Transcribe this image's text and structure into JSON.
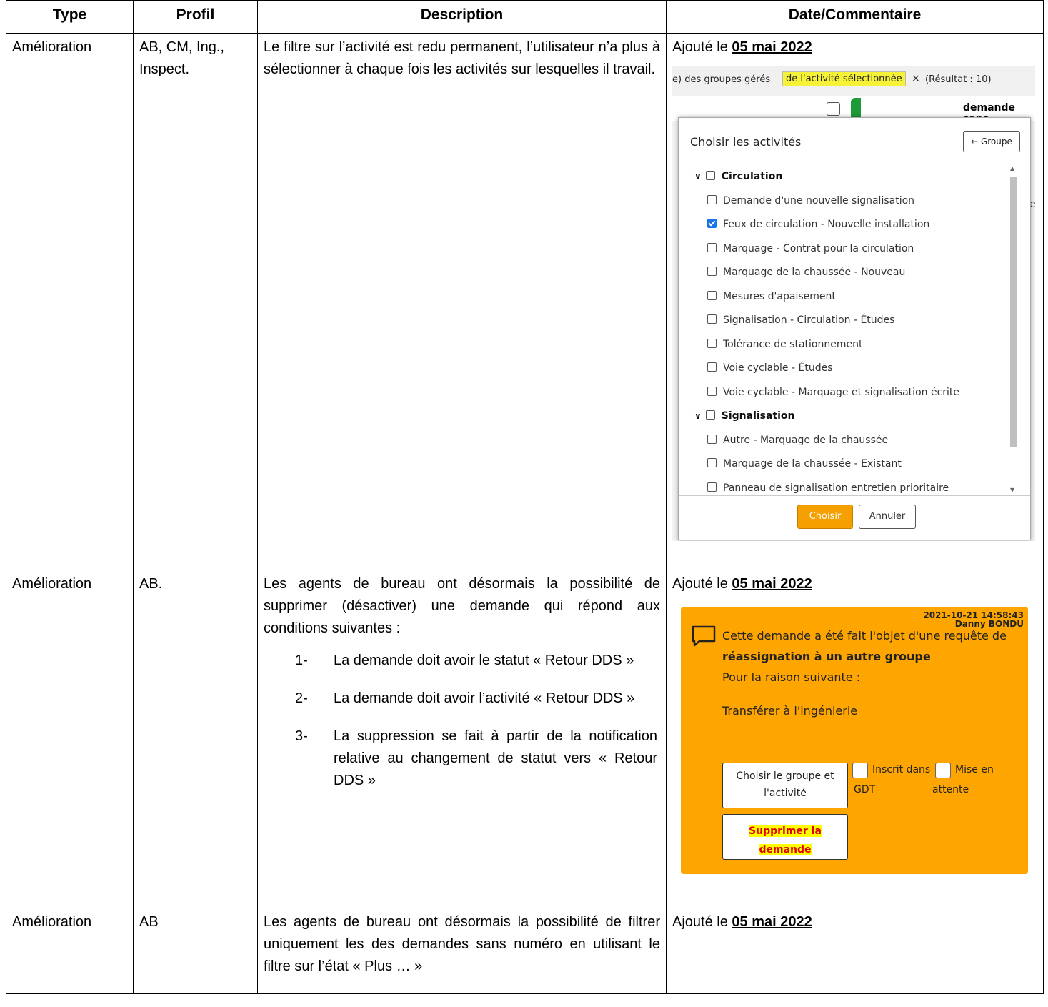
{
  "headers": {
    "type": "Type",
    "profil": "Profil",
    "description": "Description",
    "date": "Date/Commentaire"
  },
  "rows": [
    {
      "type": "Amélioration",
      "profil": "AB, CM, Ing., Inspect.",
      "description": "Le filtre sur l’activité est redu permanent, l’utilisateur n’a plus à sélectionner à chaque fois les activités sur lesquelles il travail.",
      "added_prefix": "Ajouté le ",
      "added_date": "05 mai 2022"
    },
    {
      "type": "Amélioration",
      "profil": "AB.",
      "description_intro": "Les agents de bureau ont désormais la possibilité de supprimer (désactiver) une demande qui répond aux conditions suivantes :",
      "conditions": [
        {
          "num": "1-",
          "text": "La demande doit avoir le statut « Retour DDS »"
        },
        {
          "num": "2-",
          "text": "La demande doit avoir l’activité « Retour DDS »"
        },
        {
          "num": "3-",
          "text": "La suppression se fait à partir de la notification relative au changement de statut vers « Retour DDS »"
        }
      ],
      "added_prefix": "Ajouté le ",
      "added_date": "05 mai 2022"
    },
    {
      "type": "Amélioration",
      "profil": "AB",
      "description": "Les agents de bureau ont désormais la possibilité de filtrer uniquement les des demandes sans numéro en utilisant le filtre sur l’état « Plus … »",
      "added_prefix": "Ajouté le ",
      "added_date": "05 mai 2022"
    }
  ],
  "screenshot1": {
    "filter_prefix": "e) des groupes gérés",
    "filter_highlight": "de l'activité sélectionnée",
    "filter_close": "×",
    "result": "(Résultat : 10)",
    "row_text": "demande sans",
    "dialog_title": "Choisir les activités",
    "group_button": "← Groupe",
    "groups": [
      {
        "name": "Circulation",
        "items": [
          {
            "label": "Demande d'une nouvelle signalisation",
            "checked": false
          },
          {
            "label": "Feux de circulation - Nouvelle installation",
            "checked": true
          },
          {
            "label": "Marquage - Contrat pour la circulation",
            "checked": false
          },
          {
            "label": "Marquage de la chaussée - Nouveau",
            "checked": false
          },
          {
            "label": "Mesures d'apaisement",
            "checked": false
          },
          {
            "label": "Signalisation - Circulation - Études",
            "checked": false
          },
          {
            "label": "Tolérance de stationnement",
            "checked": false
          },
          {
            "label": "Voie cyclable - Études",
            "checked": false
          },
          {
            "label": "Voie cyclable - Marquage et signalisation écrite",
            "checked": false
          }
        ]
      },
      {
        "name": "Signalisation",
        "items": [
          {
            "label": "Autre - Marquage de la chaussée",
            "checked": false
          },
          {
            "label": "Marquage de la chaussée - Existant",
            "checked": false
          },
          {
            "label": "Panneau de signalisation entretien prioritaire",
            "checked": false
          }
        ]
      }
    ],
    "choose_button": "Choisir",
    "cancel_button": "Annuler",
    "accent_color": "#f5a000"
  },
  "screenshot2": {
    "timestamp": "2021-10-21 14:58:43",
    "author": "Danny BONDU",
    "line1": "Cette demande a été fait l'objet d'une requête de",
    "line2": "réassignation à un autre groupe",
    "line3": "Pour la raison suivante :",
    "line4": "Transférer à l'ingénierie",
    "btn_choose": "Choisir le groupe et l'activité",
    "chk_gdt_label": "Inscrit dans GDT",
    "chk_wait_label": "Mise en attente",
    "btn_delete_line1": "Supprimer la",
    "btn_delete_line2": "demande",
    "background_color": "#ffa500"
  }
}
